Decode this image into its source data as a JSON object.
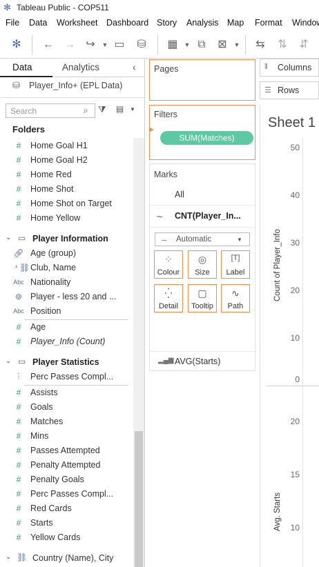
{
  "window": {
    "title": "Tableau Public - COP511"
  },
  "menu": [
    "File",
    "Data",
    "Worksheet",
    "Dashboard",
    "Story",
    "Analysis",
    "Map",
    "Format",
    "Window"
  ],
  "pane": {
    "tabs": [
      "Data",
      "Analytics"
    ],
    "datasource": "Player_Info+ (EPL Data)",
    "search_placeholder": "Search",
    "folders_label": "Folders",
    "fields_top": [
      {
        "icon": "#",
        "label": "Home Goal H1"
      },
      {
        "icon": "#",
        "label": "Home Goal H2"
      },
      {
        "icon": "#",
        "label": "Home Red"
      },
      {
        "icon": "#",
        "label": "Home Shot"
      },
      {
        "icon": "#",
        "label": "Home Shot on Target"
      },
      {
        "icon": "#",
        "label": "Home Yellow"
      }
    ],
    "group_player_info": "Player Information",
    "player_info_fields": [
      {
        "icon": "link",
        "label": "Age (group)"
      },
      {
        "icon": "hier",
        "label": "Club, Name"
      },
      {
        "icon": "Abc",
        "label": "Nationality"
      },
      {
        "icon": "set",
        "label": "Player - less 20 and ..."
      },
      {
        "icon": "Abc",
        "label": "Position"
      },
      {
        "icon": "#",
        "label": "Age"
      },
      {
        "icon": "#",
        "label": "Player_Info (Count)"
      }
    ],
    "group_player_stats": "Player Statistics",
    "player_stats_fields": [
      {
        "icon": "bin",
        "label": "Perc Passes Compl..."
      },
      {
        "icon": "#",
        "label": "Assists"
      },
      {
        "icon": "#",
        "label": "Goals"
      },
      {
        "icon": "#",
        "label": "Matches"
      },
      {
        "icon": "#",
        "label": "Mins"
      },
      {
        "icon": "#",
        "label": "Passes Attempted"
      },
      {
        "icon": "#",
        "label": "Penalty Attempted"
      },
      {
        "icon": "#",
        "label": "Penalty Goals"
      },
      {
        "icon": "#",
        "label": "Perc Passes Compl..."
      },
      {
        "icon": "#",
        "label": "Red Cards"
      },
      {
        "icon": "#",
        "label": "Starts"
      },
      {
        "icon": "#",
        "label": "Yellow Cards"
      }
    ],
    "group_country": "Country (Name), City"
  },
  "shelves": {
    "pages": "Pages",
    "filters": "Filters",
    "filter_pill": "SUM(Matches)",
    "columns": "Columns",
    "rows": "Rows"
  },
  "marks": {
    "title": "Marks",
    "all": "All",
    "measure1": "CNT(Player_In...",
    "mark_type": "Automatic",
    "buttons": [
      "Colour",
      "Size",
      "Label",
      "Detail",
      "Tooltip",
      "Path"
    ],
    "measure2": "AVG(Starts)"
  },
  "sheet": {
    "title": "Sheet 1",
    "axis1_label": "Count of Player_Info",
    "axis1_ticks": [
      "50",
      "40",
      "30",
      "20",
      "10",
      "0"
    ],
    "axis2_label": "Avg. Starts",
    "axis2_ticks": [
      "20",
      "15",
      "10"
    ]
  }
}
